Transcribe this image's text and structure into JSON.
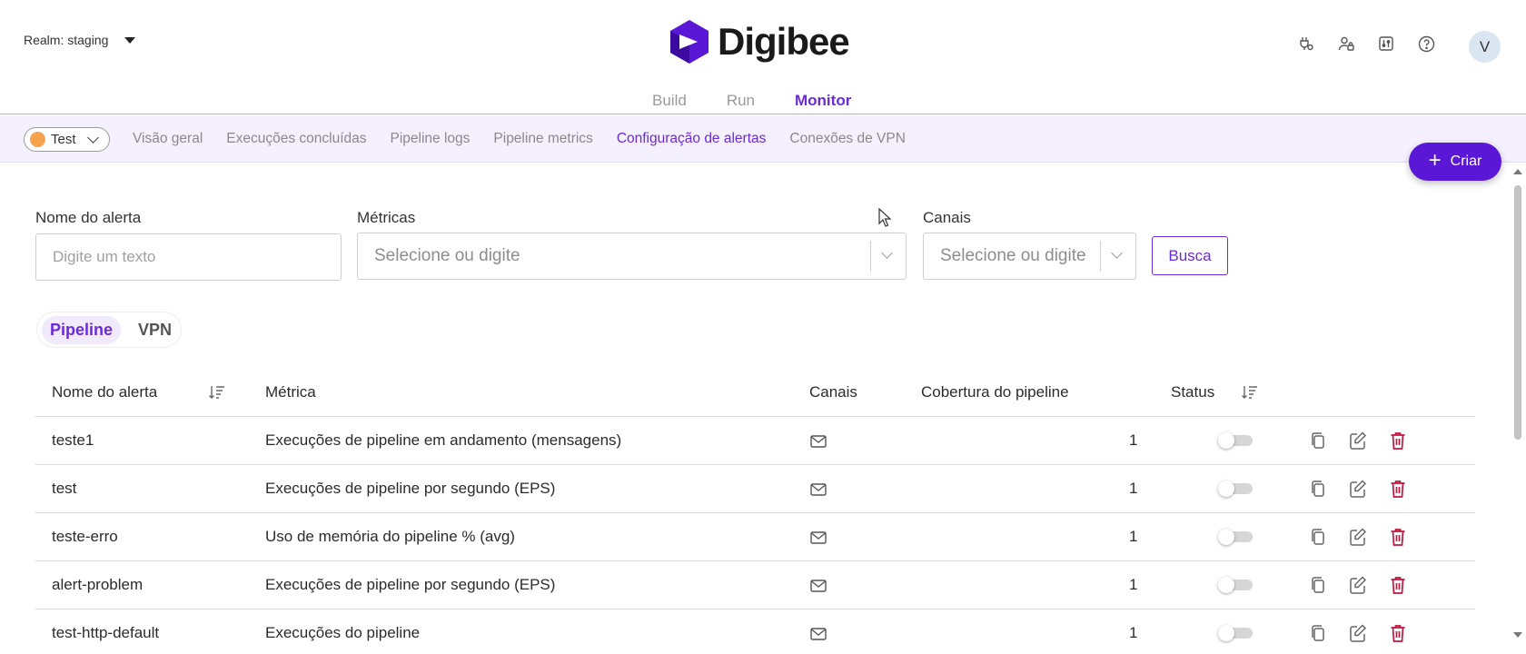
{
  "header": {
    "realm_label": "Realm: staging",
    "logo_text": "Digibee",
    "avatar_initial": "V",
    "icons": [
      "plug-settings-icon",
      "user-lock-icon",
      "sliders-icon",
      "help-icon"
    ],
    "nav": [
      {
        "label": "Build",
        "active": false
      },
      {
        "label": "Run",
        "active": false
      },
      {
        "label": "Monitor",
        "active": true
      }
    ]
  },
  "subnav": {
    "environment": "Test",
    "environment_color": "#f5a34c",
    "tabs": [
      {
        "label": "Visão geral"
      },
      {
        "label": "Execuções concluídas"
      },
      {
        "label": "Pipeline logs"
      },
      {
        "label": "Pipeline metrics"
      },
      {
        "label": "Configuração de alertas",
        "active": true
      },
      {
        "label": "Conexões de VPN"
      }
    ]
  },
  "create_button": "Criar",
  "filters": {
    "name_label": "Nome do alerta",
    "name_placeholder": "Digite um texto",
    "metrics_label": "Métricas",
    "metrics_placeholder": "Selecione ou digite",
    "channels_label": "Canais",
    "channels_placeholder": "Selecione ou digite",
    "search_button": "Busca"
  },
  "segment": {
    "options": [
      "Pipeline",
      "VPN"
    ],
    "selected": "Pipeline"
  },
  "table": {
    "columns": {
      "name": "Nome do alerta",
      "metric": "Métrica",
      "channels": "Canais",
      "coverage": "Cobertura do pipeline",
      "status": "Status"
    },
    "rows": [
      {
        "name": "teste1",
        "metric": "Execuções de pipeline em andamento (mensagens)",
        "channel_icon": "mail-icon",
        "coverage": "1",
        "enabled": false
      },
      {
        "name": "test",
        "metric": "Execuções de pipeline por segundo (EPS)",
        "channel_icon": "mail-icon",
        "coverage": "1",
        "enabled": false
      },
      {
        "name": "teste-erro",
        "metric": "Uso de memória do pipeline % (avg)",
        "channel_icon": "mail-icon",
        "coverage": "1",
        "enabled": false
      },
      {
        "name": "alert-problem",
        "metric": "Execuções de pipeline por segundo (EPS)",
        "channel_icon": "mail-icon",
        "coverage": "1",
        "enabled": false
      },
      {
        "name": "test-http-default",
        "metric": "Execuções do pipeline",
        "channel_icon": "mail-icon",
        "coverage": "1",
        "enabled": false
      }
    ]
  },
  "colors": {
    "accent": "#6b2bd6",
    "create_button": "#5a17d6",
    "delete_icon": "#c0163c",
    "subnav_bg": "#f4f0fd"
  }
}
